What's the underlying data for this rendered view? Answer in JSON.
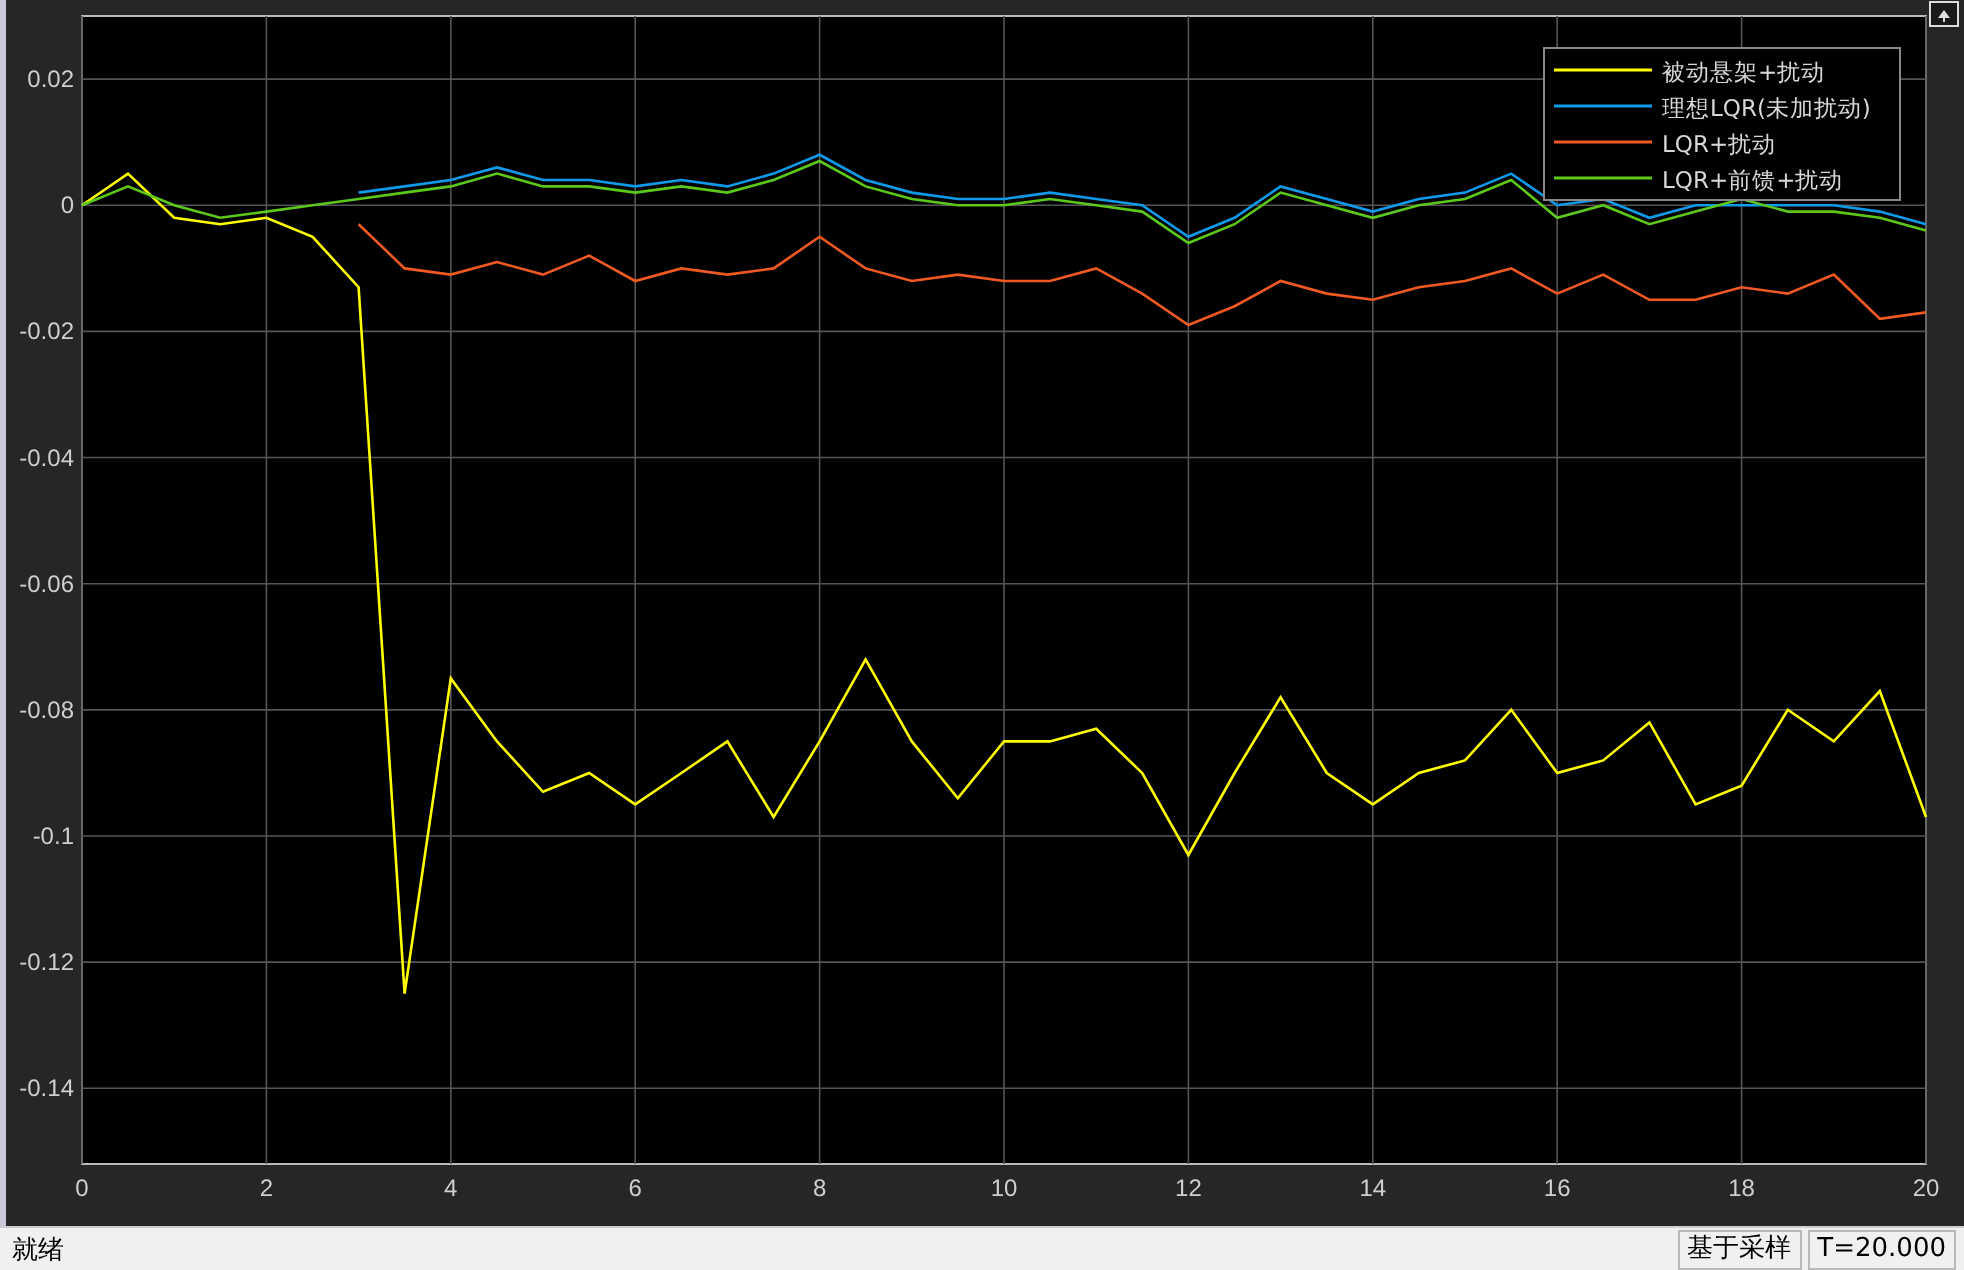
{
  "plot": {
    "chart_data": {
      "type": "line",
      "x": [
        0,
        0.5,
        1,
        1.5,
        2,
        2.5,
        3,
        3.5,
        4,
        4.5,
        5,
        5.5,
        6,
        6.5,
        7,
        7.5,
        8,
        8.5,
        9,
        9.5,
        10,
        10.5,
        11,
        11.5,
        12,
        12.5,
        13,
        13.5,
        14,
        14.5,
        15,
        15.5,
        16,
        16.5,
        17,
        17.5,
        18,
        18.5,
        19,
        19.5,
        20
      ],
      "series": [
        {
          "name": "被动悬架+扰动",
          "color": "#ffff00",
          "values": [
            0,
            0.005,
            -0.002,
            -0.003,
            -0.002,
            -0.005,
            -0.013,
            -0.125,
            -0.075,
            -0.085,
            -0.093,
            -0.09,
            -0.095,
            -0.09,
            -0.085,
            -0.097,
            -0.085,
            -0.072,
            -0.085,
            -0.094,
            -0.085,
            -0.085,
            -0.083,
            -0.09,
            -0.103,
            -0.09,
            -0.078,
            -0.09,
            -0.095,
            -0.09,
            -0.088,
            -0.08,
            -0.09,
            -0.088,
            -0.082,
            -0.095,
            -0.092,
            -0.08,
            -0.085,
            -0.077,
            -0.097
          ]
        },
        {
          "name": "理想LQR(未加扰动)",
          "color": "#0f9aeb",
          "values": [
            null,
            null,
            null,
            null,
            null,
            null,
            0.002,
            0.003,
            0.004,
            0.006,
            0.004,
            0.004,
            0.003,
            0.004,
            0.003,
            0.005,
            0.008,
            0.004,
            0.002,
            0.001,
            0.001,
            0.002,
            0.001,
            0,
            -0.005,
            -0.002,
            0.003,
            0.001,
            -0.001,
            0.001,
            0.002,
            0.005,
            0,
            0.001,
            -0.002,
            0,
            0,
            0,
            0,
            -0.001,
            -0.003
          ]
        },
        {
          "name": "LQR+扰动",
          "color": "#f05a22",
          "values": [
            null,
            null,
            null,
            null,
            null,
            null,
            -0.003,
            -0.01,
            -0.011,
            -0.009,
            -0.011,
            -0.008,
            -0.012,
            -0.01,
            -0.011,
            -0.01,
            -0.005,
            -0.01,
            -0.012,
            -0.011,
            -0.012,
            -0.012,
            -0.01,
            -0.014,
            -0.019,
            -0.016,
            -0.012,
            -0.014,
            -0.015,
            -0.013,
            -0.012,
            -0.01,
            -0.014,
            -0.011,
            -0.015,
            -0.015,
            -0.013,
            -0.014,
            -0.011,
            -0.018,
            -0.017
          ]
        },
        {
          "name": "LQR+前馈+扰动",
          "color": "#5cc91a",
          "values": [
            0,
            0.003,
            0,
            -0.002,
            -0.001,
            0,
            0.001,
            0.002,
            0.003,
            0.005,
            0.003,
            0.003,
            0.002,
            0.003,
            0.002,
            0.004,
            0.007,
            0.003,
            0.001,
            0,
            0,
            0.001,
            0,
            -0.001,
            -0.006,
            -0.003,
            0.002,
            0,
            -0.002,
            0,
            0.001,
            0.004,
            -0.002,
            0,
            -0.003,
            -0.001,
            0.001,
            -0.001,
            -0.001,
            -0.002,
            -0.004
          ]
        }
      ],
      "grid": true,
      "legend": true,
      "xlim": [
        0,
        20
      ],
      "ylim": [
        -0.152,
        0.03
      ],
      "xticks": [
        0,
        2,
        4,
        6,
        8,
        10,
        12,
        14,
        16,
        18,
        20
      ],
      "yticks": [
        -0.14,
        -0.12,
        -0.1,
        -0.08,
        -0.06,
        -0.04,
        -0.02,
        0,
        0.02
      ]
    }
  },
  "status_bar": {
    "state": "就绪",
    "mode": "基于采样",
    "time": "T=20.000"
  }
}
